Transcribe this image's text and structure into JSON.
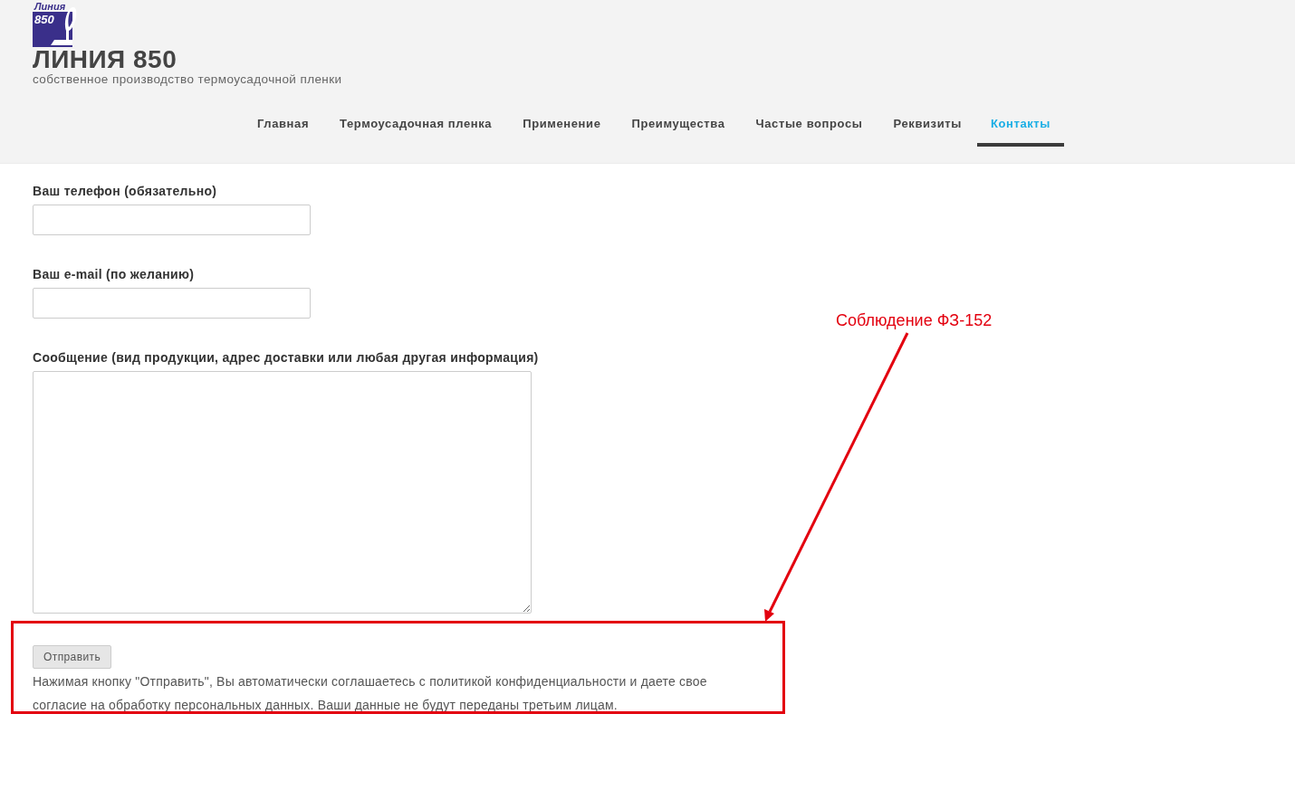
{
  "logo": {
    "line_1": "Линия",
    "line_2": "850"
  },
  "site_title": "ЛИНИЯ 850",
  "tagline": "собственное производство термоусадочной пленки",
  "nav": [
    {
      "label": "Главная",
      "selected": false
    },
    {
      "label": "Термоусадочная пленка",
      "selected": false
    },
    {
      "label": "Применение",
      "selected": false
    },
    {
      "label": "Преимущества",
      "selected": false
    },
    {
      "label": "Частые вопросы",
      "selected": false
    },
    {
      "label": "Реквизиты",
      "selected": false
    },
    {
      "label": "Контакты",
      "selected": true
    }
  ],
  "form": {
    "fields": [
      {
        "kind": "input",
        "label": "Ваш телефон (обязательно)"
      },
      {
        "kind": "input",
        "label": "Ваш e-mail (по желанию)"
      },
      {
        "kind": "textarea",
        "label": "Сообщение (вид продукции, адрес доставки или любая другая информация)"
      }
    ],
    "submit_button": "Отправить",
    "consent_text": "Нажимая кнопку \"Отправить\", Вы автоматически соглашаетесь с политикой конфиденциальности и даете свое согласие на обработку персональных данных. Ваши данные не будут переданы третьим лицам."
  },
  "annotation": {
    "text": "Соблюдение ФЗ-152"
  }
}
